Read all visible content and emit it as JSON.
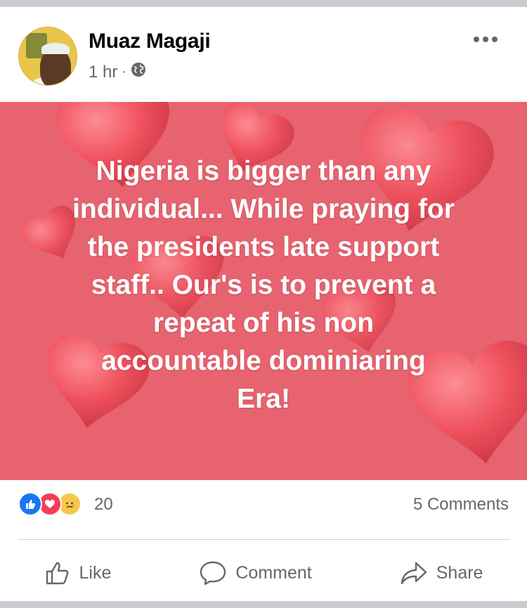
{
  "post": {
    "author": "Muaz Magaji",
    "time": "1 hr",
    "separator": "·",
    "audience_icon": "globe-icon",
    "message": "Nigeria is bigger than any\nindividual... While praying for\nthe presidents late support\nstaff.. Our's is to prevent a\nrepeat of his non\naccountable  dominiaring\nEra!",
    "background_color": "#e6636f"
  },
  "reactions": {
    "types": [
      "like-icon",
      "love-icon",
      "sad-icon"
    ],
    "count": "20"
  },
  "comments": {
    "label": "5 Comments"
  },
  "actions": {
    "like": "Like",
    "comment": "Comment",
    "share": "Share"
  },
  "colors": {
    "secondary_text": "#65676b",
    "like_blue": "#1877f2",
    "love_red": "#f33e58"
  }
}
